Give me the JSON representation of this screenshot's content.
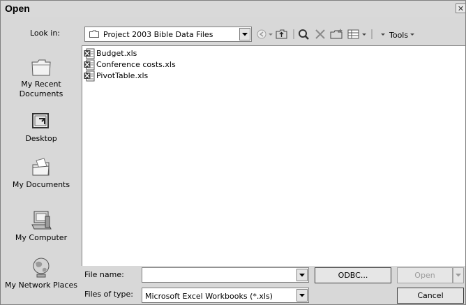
{
  "dialog": {
    "title": "Open",
    "close_glyph": "✕"
  },
  "look_in": {
    "label": "Look in:",
    "value": "Project 2003 Bible Data Files"
  },
  "toolbar": {
    "icons": [
      "back-icon",
      "up-folder-icon",
      "search-web-icon",
      "delete-icon",
      "new-folder-icon",
      "views-icon"
    ],
    "tools_label": "Tools"
  },
  "places": [
    {
      "label": "My Recent Documents",
      "icon": "recent-documents-icon"
    },
    {
      "label": "Desktop",
      "icon": "desktop-icon"
    },
    {
      "label": "My Documents",
      "icon": "my-documents-icon"
    },
    {
      "label": "My Computer",
      "icon": "my-computer-icon"
    },
    {
      "label": "My Network Places",
      "icon": "network-places-icon"
    }
  ],
  "files": [
    {
      "name": "Budget.xls"
    },
    {
      "name": "Conference costs.xls"
    },
    {
      "name": "PivotTable.xls"
    }
  ],
  "file_name": {
    "label": "File name:",
    "value": ""
  },
  "file_type": {
    "label": "Files of type:",
    "value": "Microsoft Excel Workbooks (*.xls)"
  },
  "buttons": {
    "odbc": "ODBC...",
    "open": "Open",
    "cancel": "Cancel"
  },
  "colors": {
    "dialog_bg": "#d8d8d8",
    "list_bg": "#ffffff",
    "disabled_text": "#9c9c9c"
  }
}
